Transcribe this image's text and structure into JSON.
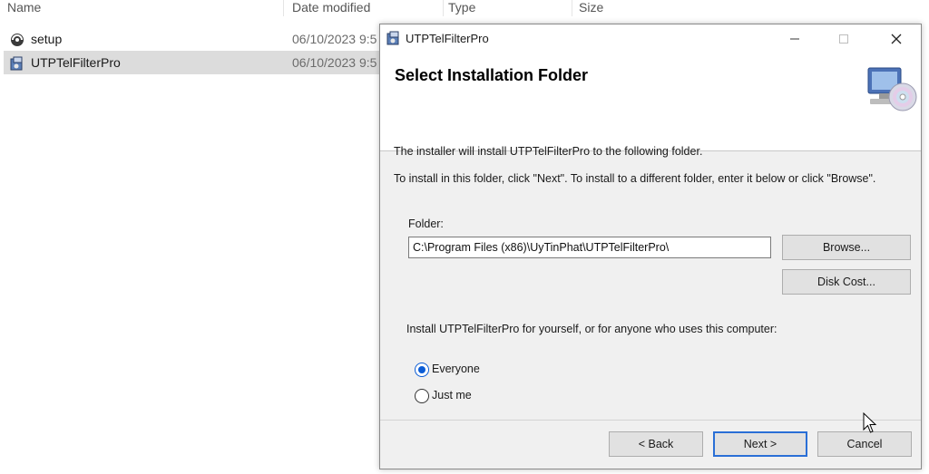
{
  "explorer": {
    "columns": [
      "Name",
      "Date modified",
      "Type",
      "Size"
    ],
    "files": [
      {
        "name": "setup",
        "date": "06/10/2023 9:5"
      },
      {
        "name": "UTPTelFilterPro",
        "date": "06/10/2023 9:5"
      }
    ]
  },
  "dialog": {
    "title": "UTPTelFilterPro",
    "header_title": "Select Installation Folder",
    "line1": "The installer will install UTPTelFilterPro to the following folder.",
    "line2": "To install in this folder, click \"Next\". To install to a different folder, enter it below or click \"Browse\".",
    "folder_label": "Folder:",
    "folder_value": "C:\\Program Files (x86)\\UyTinPhat\\UTPTelFilterPro\\",
    "browse_label": "Browse...",
    "disk_cost_label": "Disk Cost...",
    "install_for_label": "Install UTPTelFilterPro for yourself, or for anyone who uses this computer:",
    "radio_everyone": "Everyone",
    "radio_just_me": "Just me",
    "back_label": "< Back",
    "next_label": "Next >",
    "cancel_label": "Cancel"
  },
  "colors": {
    "accent": "#0b5cd5",
    "default_button_border": "#2a6fd6",
    "dialog_bg": "#f0f0f0",
    "selection": "#dcdcdc"
  }
}
